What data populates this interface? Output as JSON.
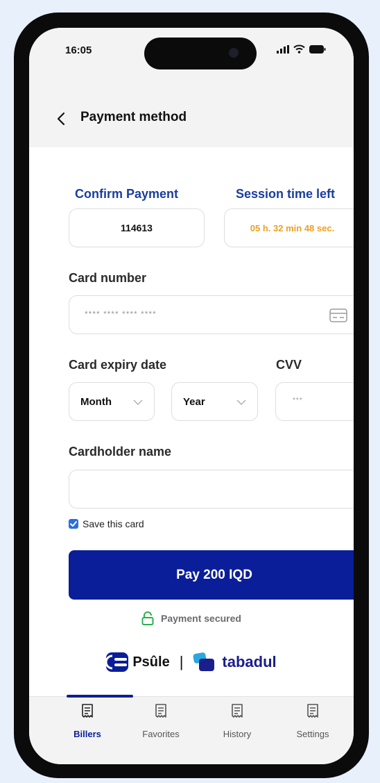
{
  "status_bar": {
    "time": "16:05"
  },
  "header": {
    "title": "Payment method"
  },
  "confirm": {
    "label": "Confirm Payment",
    "code": "114613"
  },
  "session": {
    "label": "Session time left",
    "value": "05 h. 32 min 48 sec."
  },
  "card_number": {
    "label": "Card number",
    "placeholder": "**** **** **** ****"
  },
  "expiry": {
    "label": "Card expiry date",
    "month": "Month",
    "year": "Year"
  },
  "cvv": {
    "label": "CVV",
    "placeholder": "***"
  },
  "cardholder": {
    "label": "Cardholder name",
    "value": ""
  },
  "save_card": {
    "label": "Save this card",
    "checked": true
  },
  "pay_button": {
    "label": "Pay 200 IQD"
  },
  "secured_text": "Payment secured",
  "brands": {
    "left": "Psûle",
    "separator": "|",
    "right": "tabadul"
  },
  "tabs": [
    {
      "label": "Billers",
      "icon": "receipt-icon",
      "active": true
    },
    {
      "label": "Favorites",
      "icon": "receipt-icon",
      "active": false
    },
    {
      "label": "History",
      "icon": "receipt-icon",
      "active": false
    },
    {
      "label": "Settings",
      "icon": "receipt-icon",
      "active": false
    }
  ],
  "colors": {
    "primary": "#0a1e99",
    "accent_blue": "#1a3e9e",
    "timer": "#f0a020",
    "background": "#e8f0fc"
  }
}
